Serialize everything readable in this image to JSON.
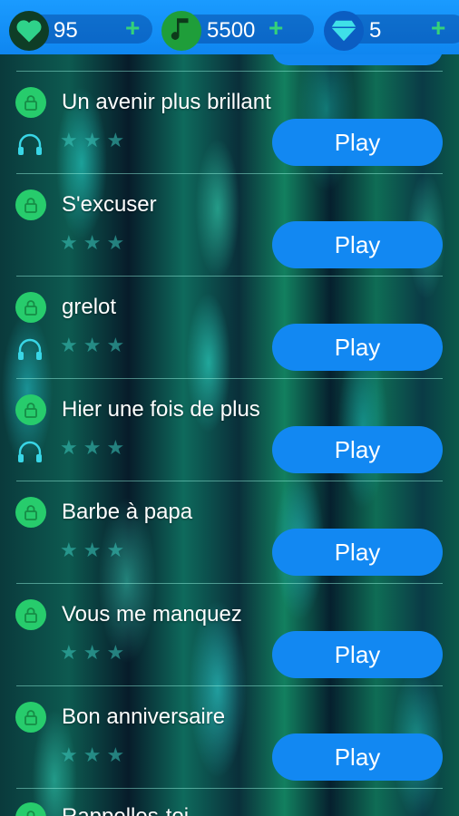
{
  "currencies": {
    "hearts": {
      "value": "95",
      "icon": "heart-icon",
      "plus": "+"
    },
    "notes": {
      "value": "5500",
      "icon": "music-note-icon",
      "plus": "+"
    },
    "gems": {
      "value": "5",
      "icon": "diamond-icon",
      "plus": "+"
    }
  },
  "songs": [
    {
      "title": "Un avenir plus brillant",
      "play_label": "Play",
      "has_headphones": true,
      "stars": 0
    },
    {
      "title": "S'excuser",
      "play_label": "Play",
      "has_headphones": false,
      "stars": 0
    },
    {
      "title": "grelot",
      "play_label": "Play",
      "has_headphones": true,
      "stars": 0
    },
    {
      "title": "Hier une fois de plus",
      "play_label": "Play",
      "has_headphones": true,
      "stars": 0
    },
    {
      "title": "Barbe à papa",
      "play_label": "Play",
      "has_headphones": false,
      "stars": 0
    },
    {
      "title": "Vous me manquez",
      "play_label": "Play",
      "has_headphones": false,
      "stars": 0
    },
    {
      "title": "Bon anniversaire",
      "play_label": "Play",
      "has_headphones": false,
      "stars": 0
    }
  ],
  "partial_song": {
    "title": "Rappelles-toi"
  },
  "colors": {
    "topbar": "#1a9bff",
    "play_button": "#1288f2",
    "lock_badge": "#27cc6c",
    "headphone": "#39d6e6",
    "plus": "#35d27a"
  }
}
